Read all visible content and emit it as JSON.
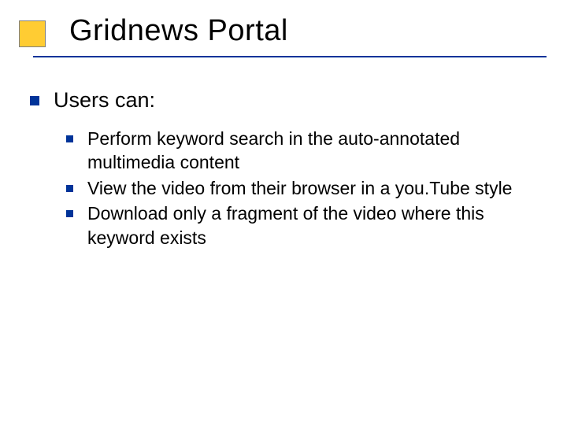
{
  "slide": {
    "title": "Gridnews Portal",
    "level1": "Users can:",
    "items": [
      "Perform keyword search in the auto-annotated multimedia content",
      "View the video from their browser in a you.Tube style",
      "Download only a fragment of the video where this keyword exists"
    ]
  }
}
